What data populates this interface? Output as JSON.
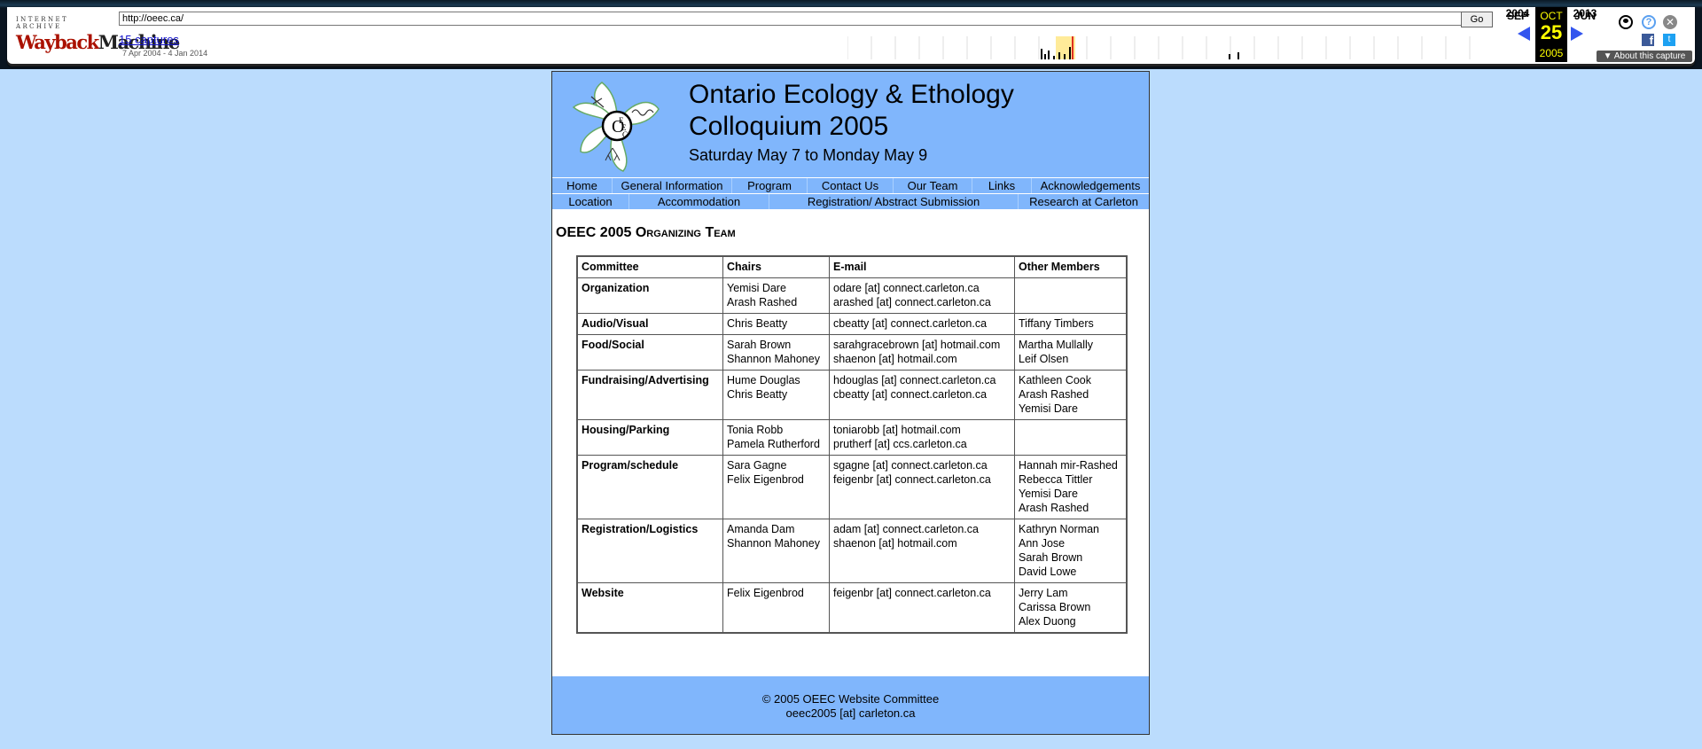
{
  "wayback": {
    "logo_top": "INTERNET ARCHIVE",
    "logo_wayback": "Wayback",
    "logo_machine": "Machine",
    "url": "http://oeec.ca/",
    "go_label": "Go",
    "captures_label": "15 captures",
    "date_range": "7 Apr 2004 - 4 Jan 2014",
    "prev_month": "SEP",
    "cur_month": "OCT",
    "next_month": "JUN",
    "cur_day": "25",
    "prev_year": "2004",
    "cur_year": "2005",
    "next_year": "2013",
    "about_label": "▼ About this capture",
    "accent_color": "#3355ee"
  },
  "site": {
    "title_line1": "Ontario Ecology & Ethology",
    "title_line2": "Colloquium 2005",
    "date": "Saturday May 7 to Monday May 9",
    "logo_letters": [
      "O",
      "E",
      "E",
      "C"
    ],
    "nav_row1": [
      "Home",
      "General Information",
      "Program",
      "Contact Us",
      "Our Team",
      "Links",
      "Acknowledgements"
    ],
    "nav_row2": [
      "Location",
      "Accommodation",
      "Registration/ Abstract Submission",
      "Research at Carleton"
    ],
    "heading": "OEEC 2005 Organizing Team",
    "table_headers": [
      "Committee",
      "Chairs",
      "E-mail",
      "Other Members"
    ],
    "rows": [
      {
        "committee": "Organization",
        "chairs": [
          "Yemisi Dare",
          "Arash Rashed"
        ],
        "emails": [
          "odare [at] connect.carleton.ca",
          "arashed [at] connect.carleton.ca"
        ],
        "members": []
      },
      {
        "committee": "Audio/Visual",
        "chairs": [
          "Chris Beatty"
        ],
        "emails": [
          "cbeatty [at] connect.carleton.ca"
        ],
        "members": [
          "Tiffany Timbers"
        ]
      },
      {
        "committee": "Food/Social",
        "chairs": [
          "Sarah Brown",
          "Shannon Mahoney"
        ],
        "emails": [
          "sarahgracebrown [at] hotmail.com",
          "shaenon [at] hotmail.com"
        ],
        "members": [
          "Martha Mullally",
          "Leif Olsen"
        ]
      },
      {
        "committee": "Fundraising/Advertising",
        "chairs": [
          "Hume Douglas",
          "Chris Beatty"
        ],
        "emails": [
          "hdouglas [at] connect.carleton.ca",
          "cbeatty [at] connect.carleton.ca"
        ],
        "members": [
          "Kathleen Cook",
          "Arash Rashed",
          "Yemisi Dare"
        ]
      },
      {
        "committee": "Housing/Parking",
        "chairs": [
          "Tonia Robb",
          "Pamela Rutherford"
        ],
        "emails": [
          "toniarobb [at] hotmail.com",
          "prutherf [at] ccs.carleton.ca"
        ],
        "members": []
      },
      {
        "committee": "Program/schedule",
        "chairs": [
          "Sara Gagne",
          "Felix Eigenbrod"
        ],
        "emails": [
          "sgagne [at] connect.carleton.ca",
          "feigenbr [at] connect.carleton.ca"
        ],
        "members": [
          "Hannah mir-Rashed",
          "Rebecca Tittler",
          "Yemisi Dare",
          "Arash Rashed"
        ]
      },
      {
        "committee": "Registration/Logistics",
        "chairs": [
          "Amanda Dam",
          "Shannon Mahoney"
        ],
        "emails": [
          "adam [at] connect.carleton.ca",
          "shaenon [at] hotmail.com"
        ],
        "members": [
          "Kathryn Norman",
          "Ann Jose",
          "Sarah Brown",
          "David Lowe"
        ]
      },
      {
        "committee": "Website",
        "chairs": [
          "Felix Eigenbrod"
        ],
        "emails": [
          "feigenbr [at] connect.carleton.ca"
        ],
        "members": [
          "Jerry Lam",
          "Carissa Brown",
          "Alex Duong"
        ]
      }
    ],
    "footer_line1": "© 2005 OEEC Website Committee",
    "footer_line2": "oeec2005 [at] carleton.ca",
    "header_bg": "#80b6fc",
    "page_bg": "#bbdcfd"
  }
}
